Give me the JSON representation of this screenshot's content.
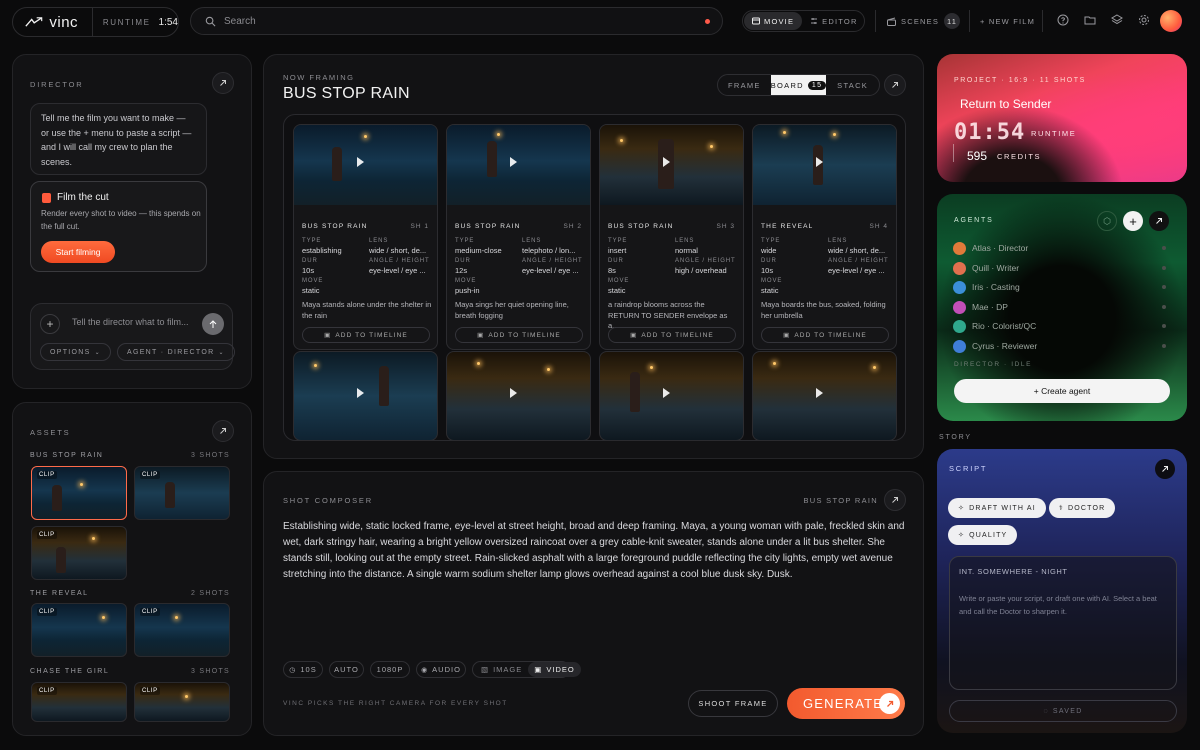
{
  "topbar": {
    "brand": "vinc",
    "runtime_label": "RUNTIME",
    "runtime_value": "1:54",
    "search_placeholder": "Search",
    "modes": [
      "MOVIE",
      "EDITOR"
    ],
    "scenes_label": "SCENES",
    "scenes_count": "11",
    "new_film": "+ NEW FILM"
  },
  "director": {
    "label": "DIRECTOR",
    "message": "Tell me the film you want to make — or use the + menu to paste a script — and I will call my crew to plan the scenes.",
    "film_title": "Film the cut",
    "film_desc": "Render every shot to video — this spends on the full cut.",
    "film_button": "Start filming",
    "input_placeholder": "Tell the director what to film...",
    "options_label": "OPTIONS",
    "agent_label": "AGENT · DIRECTOR"
  },
  "assets": {
    "label": "ASSETS",
    "clip_label": "CLIP",
    "groups": [
      {
        "name": "BUS STOP RAIN",
        "count": "3 SHOTS"
      },
      {
        "name": "THE REVEAL",
        "count": "2 SHOTS"
      },
      {
        "name": "CHASE THE GIRL",
        "count": "3 SHOTS"
      }
    ]
  },
  "board": {
    "now_label": "NOW FRAMING",
    "title": "BUS STOP RAIN",
    "tabs": [
      "FRAME",
      "BOARD",
      "STACK"
    ],
    "board_count": "15",
    "labels": {
      "type": "TYPE",
      "lens": "LENS",
      "dur": "DUR",
      "angle": "ANGLE / HEIGHT",
      "move": "MOVE"
    },
    "add_label": "ADD TO TIMELINE",
    "cards": [
      {
        "scene": "BUS STOP RAIN",
        "sh": "SH 1",
        "type": "establishing",
        "lens": "wide / short, de...",
        "dur": "10s",
        "angle": "eye-level / eye ...",
        "move": "static",
        "desc": "Maya stands alone under the shelter in the rain"
      },
      {
        "scene": "BUS STOP RAIN",
        "sh": "SH 2",
        "type": "medium-close",
        "lens": "telephoto / lon...",
        "dur": "12s",
        "angle": "eye-level / eye ...",
        "move": "push-in",
        "desc": "Maya sings her quiet opening line, breath fogging"
      },
      {
        "scene": "BUS STOP RAIN",
        "sh": "SH 3",
        "type": "insert",
        "lens": "normal",
        "dur": "8s",
        "angle": "high / overhead",
        "move": "static",
        "desc": "a raindrop blooms across the RETURN TO SENDER envelope as a..."
      },
      {
        "scene": "THE REVEAL",
        "sh": "SH 4",
        "type": "wide",
        "lens": "wide / short, de...",
        "dur": "10s",
        "angle": "eye-level / eye ...",
        "move": "static",
        "desc": "Maya boards the bus, soaked, folding her umbrella"
      }
    ]
  },
  "shot": {
    "label": "SHOT COMPOSER",
    "scene": "BUS STOP RAIN",
    "prompt": "Establishing wide, static locked frame, eye-level at street height, broad and deep framing. Maya, a young woman with pale, freckled skin and wet, dark stringy hair, wearing a bright yellow oversized raincoat over a grey cable-knit sweater, stands alone under a lit bus shelter. She stands still, looking out at the empty street. Rain-slicked asphalt with a large foreground puddle reflecting the city lights, empty wet avenue stretching into the distance. A single warm sodium shelter lamp glows overhead against a cool blue dusk sky. Dusk.",
    "chips": [
      "10S",
      "AUTO",
      "1080P",
      "AUDIO",
      "IMAGE",
      "VIDEO"
    ],
    "hint": "VINC PICKS THE RIGHT CAMERA FOR EVERY SHOT",
    "shoot_frame": "SHOOT FRAME",
    "generate": "GENERATE"
  },
  "project": {
    "meta": "PROJECT · 16:9 · 11 SHOTS",
    "title": "Return to Sender",
    "runtime_digits": "01:54",
    "runtime_label": "RUNTIME",
    "credits_value": "595",
    "credits_label": "CREDITS"
  },
  "agents": {
    "label": "AGENTS",
    "list": [
      {
        "name": "Atlas · Director",
        "color": "#e07a3a"
      },
      {
        "name": "Quill · Writer",
        "color": "#e0704e"
      },
      {
        "name": "Iris · Casting",
        "color": "#3b8fd8"
      },
      {
        "name": "Mae · DP",
        "color": "#c24fb8"
      },
      {
        "name": "Rio · Colorist/QC",
        "color": "#2fa88c"
      },
      {
        "name": "Cyrus · Reviewer",
        "color": "#3f7ed8"
      }
    ],
    "status": "DIRECTOR · IDLE",
    "create": "+ Create agent"
  },
  "story": {
    "label": "STORY",
    "script_label": "SCRIPT",
    "buttons": [
      "DRAFT WITH AI",
      "DOCTOR",
      "QUALITY"
    ],
    "heading": "INT. SOMEWHERE - NIGHT",
    "placeholder": "Write or paste your script, or draft one with AI. Select a beat and call the Doctor to sharpen it.",
    "saved": "SAVED"
  }
}
